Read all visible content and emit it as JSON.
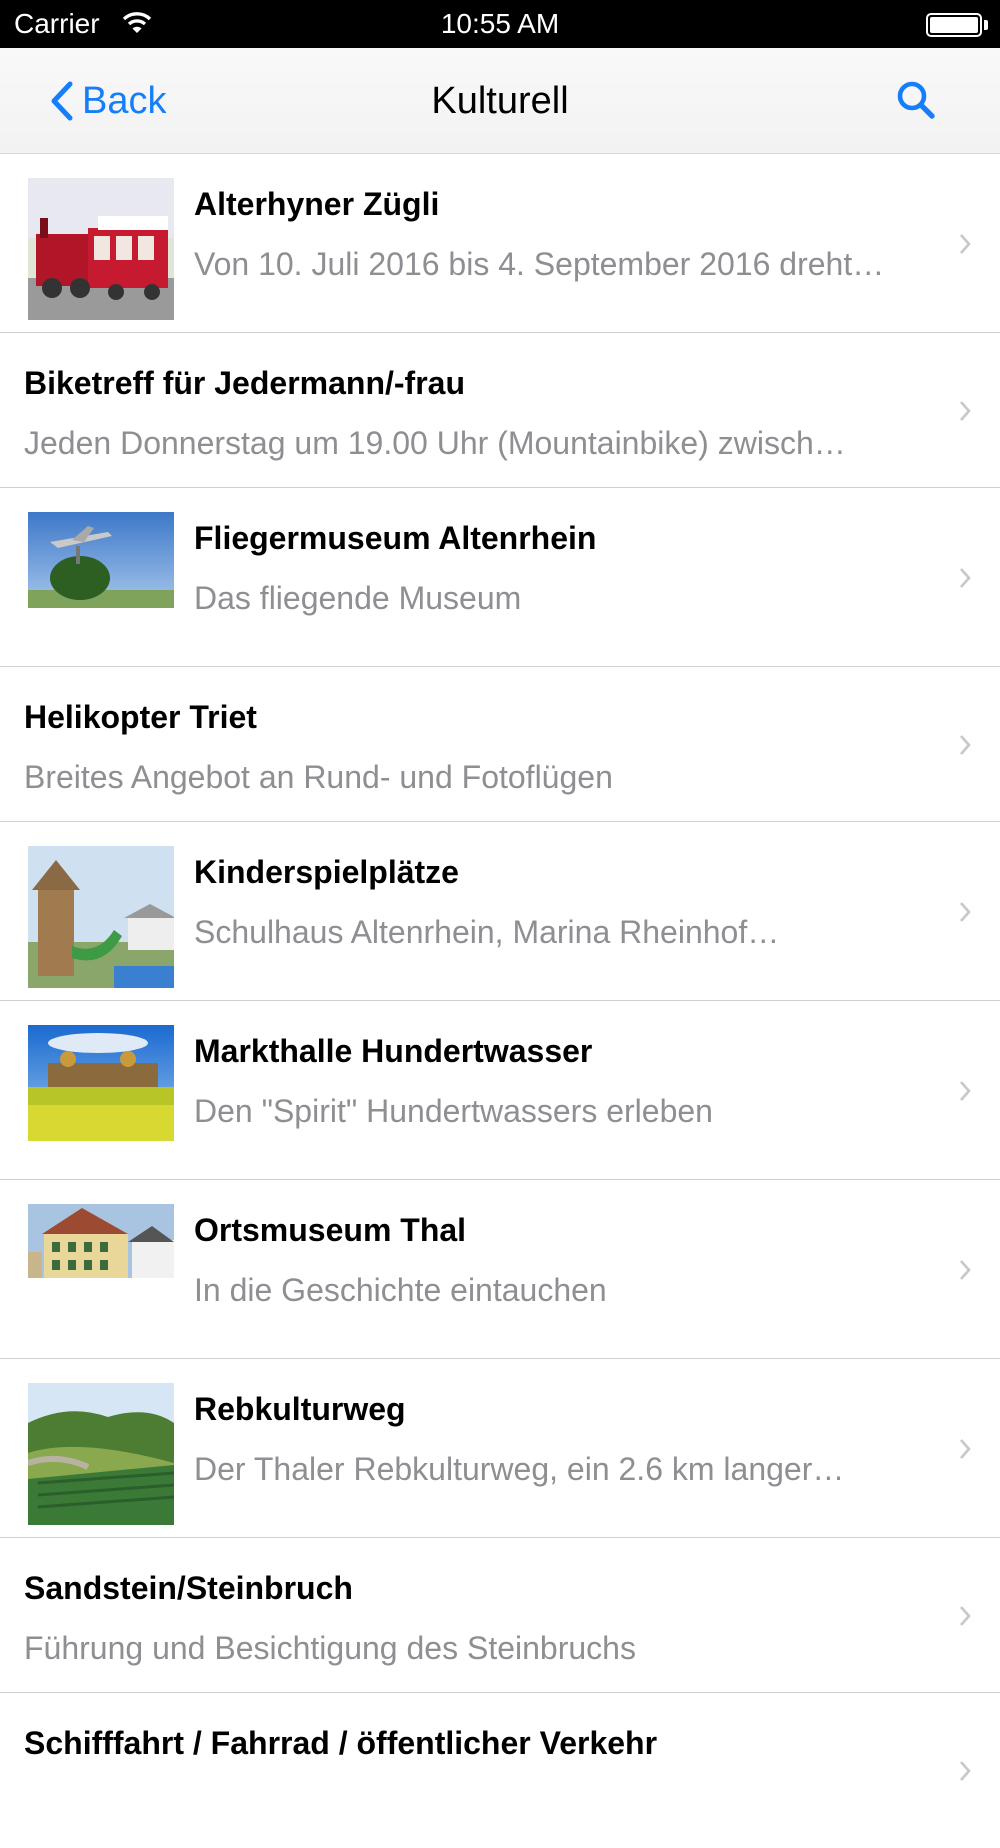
{
  "status_bar": {
    "carrier": "Carrier",
    "time": "10:55 AM"
  },
  "nav": {
    "back_label": "Back",
    "title": "Kulturell"
  },
  "items": [
    {
      "title": "Alterhyner Zügli",
      "subtitle": "Von 10. Juli 2016 bis 4. September 2016 dreht…",
      "thumbnail": "red tourist train"
    },
    {
      "title": "Biketreff für Jedermann/-frau",
      "subtitle": "Jeden Donnerstag um 19.00 Uhr (Mountainbike) zwisch…"
    },
    {
      "title": "Fliegermuseum Altenrhein",
      "subtitle": "Das fliegende Museum",
      "thumbnail": "jet on pedestal"
    },
    {
      "title": "Helikopter Triet",
      "subtitle": "Breites Angebot an Rund- und Fotoflügen"
    },
    {
      "title": "Kinderspielplätze",
      "subtitle": "Schulhaus Altenrhein, Marina Rheinhof…",
      "thumbnail": "playground with slide"
    },
    {
      "title": "Markthalle Hundertwasser",
      "subtitle": "Den \"Spirit\" Hundertwassers erleben",
      "thumbnail": "building behind yellow field"
    },
    {
      "title": "Ortsmuseum Thal",
      "subtitle": "In die Geschichte eintauchen",
      "thumbnail": "historic house"
    },
    {
      "title": "Rebkulturweg",
      "subtitle": "Der Thaler Rebkulturweg, ein 2.6 km langer…",
      "thumbnail": "vineyard hillside"
    },
    {
      "title": "Sandstein/Steinbruch",
      "subtitle": "Führung und Besichtigung des Steinbruchs"
    },
    {
      "title": "Schifffahrt / Fahrrad / öffentlicher Verkehr",
      "subtitle": ""
    }
  ],
  "colors": {
    "accent": "#147efb",
    "subtitle": "#8e8e93",
    "separator": "#d0d0d0"
  }
}
